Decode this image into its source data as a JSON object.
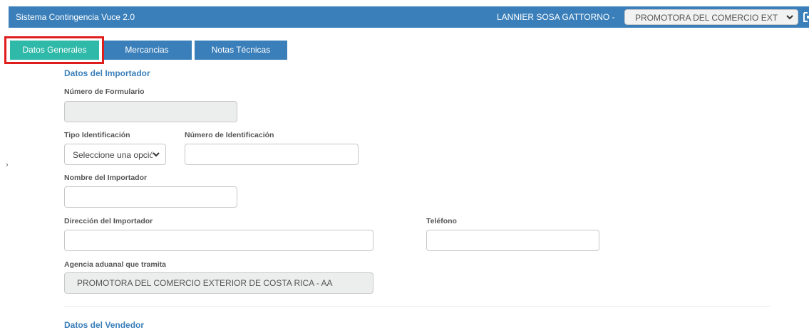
{
  "header": {
    "app_title": "Sistema Contingencia Vuce 2.0",
    "user_name": "LANNIER SOSA GATTORNO -",
    "company_selected": "PROMOTORA DEL COMERCIO EXT",
    "logout_icon": "logout-icon",
    "bg_color": "#3a7fba"
  },
  "tabs": [
    {
      "label": "Datos Generales",
      "active": true
    },
    {
      "label": "Mercancias",
      "active": false
    },
    {
      "label": "Notas Técnicas",
      "active": false
    }
  ],
  "sidebar": {
    "toggle_icon": "chevron-right-icon",
    "toggle_glyph": "›"
  },
  "importador": {
    "section_title": "Datos del Importador",
    "numero_formulario": {
      "label": "Número de Formulario",
      "value": ""
    },
    "tipo_identificacion": {
      "label": "Tipo Identificación",
      "selected": "Seleccione una opción"
    },
    "numero_identificacion": {
      "label": "Número de Identificación",
      "value": ""
    },
    "nombre": {
      "label": "Nombre del Importador",
      "value": ""
    },
    "direccion": {
      "label": "Dirección del Importador",
      "value": ""
    },
    "telefono": {
      "label": "Teléfono",
      "value": ""
    },
    "agencia": {
      "label": "Agencia aduanal que tramita",
      "value": "PROMOTORA DEL COMERCIO EXTERIOR DE COSTA RICA - AA"
    }
  },
  "vendedor": {
    "section_title": "Datos del Vendedor"
  },
  "colors": {
    "accent_active_tab": "#2fb9a8",
    "primary": "#3a7fba",
    "highlight": "#e01d1d"
  }
}
